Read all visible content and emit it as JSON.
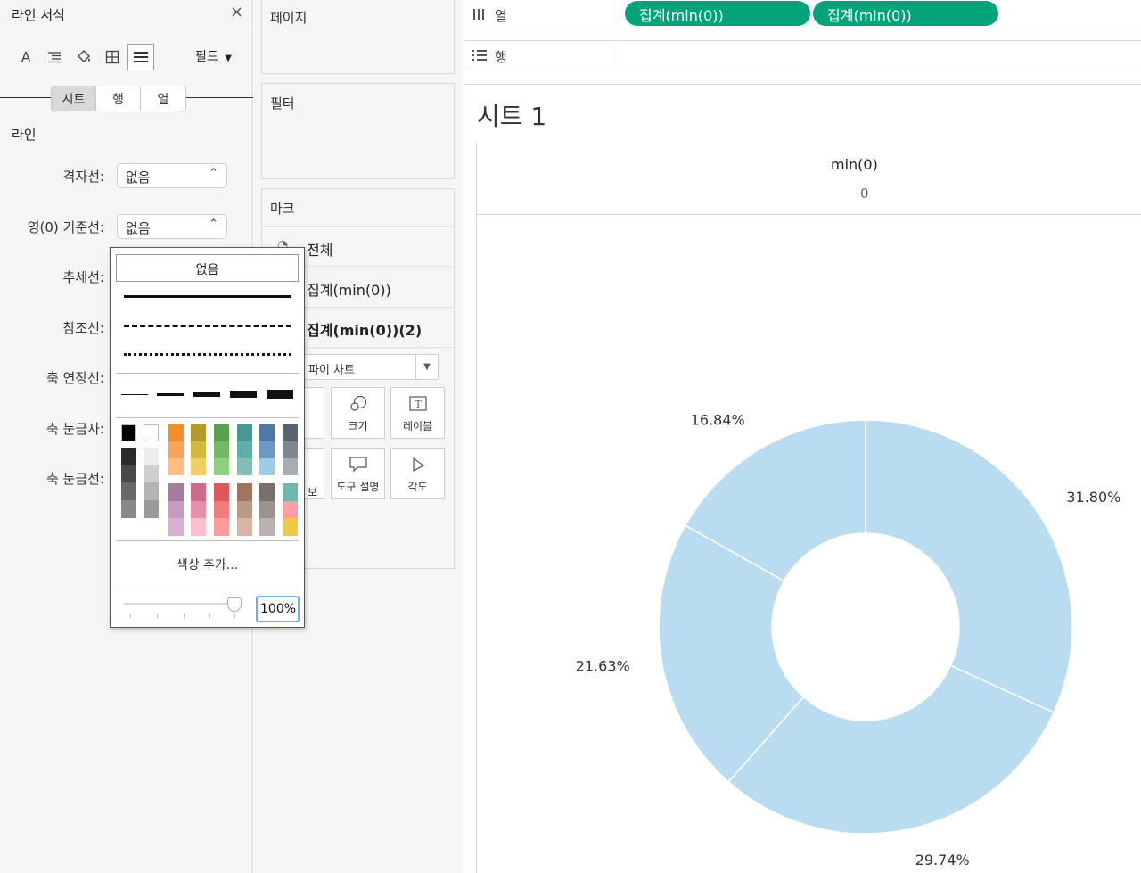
{
  "format_pane": {
    "title": "라인 서식",
    "close": "×",
    "field_menu": "필드",
    "tabs": [
      "시트",
      "행",
      "열"
    ],
    "section": "라인",
    "rows": [
      {
        "label": "격자선:",
        "value": "없음"
      },
      {
        "label": "영(0) 기준선:",
        "value": "없음"
      },
      {
        "label": "추세선:"
      },
      {
        "label": "참조선:"
      },
      {
        "label": "축 연장선:"
      },
      {
        "label": "축 눈금자:"
      },
      {
        "label": "축 눈금선:"
      }
    ]
  },
  "cards": {
    "pages_title": "페이지",
    "filters_title": "필터",
    "marks_title": "마크",
    "marks_rows": [
      "전체",
      "집계(min(0))",
      "집계(min(0))(2)"
    ],
    "mark_type": "파이 차트",
    "buttons": [
      "크기",
      "레이블",
      "보",
      "도구 설명",
      "각도"
    ]
  },
  "shelves": {
    "columns_label": "열",
    "rows_label": "행",
    "pills": [
      "집계(min(0))",
      "집계(min(0))"
    ]
  },
  "sheet": {
    "title": "시트 1",
    "column_header": "min(0)",
    "column_value": "0"
  },
  "line_popup": {
    "none": "없음",
    "add_color": "색상 추가...",
    "opacity": "100%",
    "palette": [
      [
        "#000000",
        "#2a2a2a",
        "#494949",
        "#686868",
        "#878787"
      ],
      [
        "#ffffff",
        "#ececec",
        "#cfcfcf",
        "#b4b4b4",
        "#9a9a9a"
      ],
      [
        "#f28e2b",
        "#f7a456",
        "#ffbe7d",
        "#a87aa0",
        "#c79ac0",
        "#d9b0d2"
      ],
      [
        "#b6992d",
        "#d2b83d",
        "#f1ce63",
        "#d16b8b",
        "#e68fa8",
        "#fcbdd0"
      ],
      [
        "#59a14f",
        "#74b865",
        "#8cd17d",
        "#e15759",
        "#f27c7a",
        "#ff9d9a"
      ],
      [
        "#499894",
        "#5fb0a8",
        "#86bcb6",
        "#9d7660",
        "#b89a87",
        "#d7b5a6"
      ],
      [
        "#4e79a7",
        "#6c98c8",
        "#a0cbe8",
        "#79706e",
        "#9c9290",
        "#bab0ac"
      ],
      [
        "#5a6470",
        "#7d858e",
        "#a8adb3",
        "#6eb6ae",
        "#ff9da7",
        "#edc948"
      ]
    ]
  },
  "chart_data": {
    "type": "pie",
    "style": "donut",
    "color": "#b9dcf0",
    "slices": [
      {
        "label": "31.80%",
        "value": 31.8
      },
      {
        "label": "29.74%",
        "value": 29.74
      },
      {
        "label": "21.63%",
        "value": 21.63
      },
      {
        "label": "16.84%",
        "value": 16.84
      }
    ]
  }
}
